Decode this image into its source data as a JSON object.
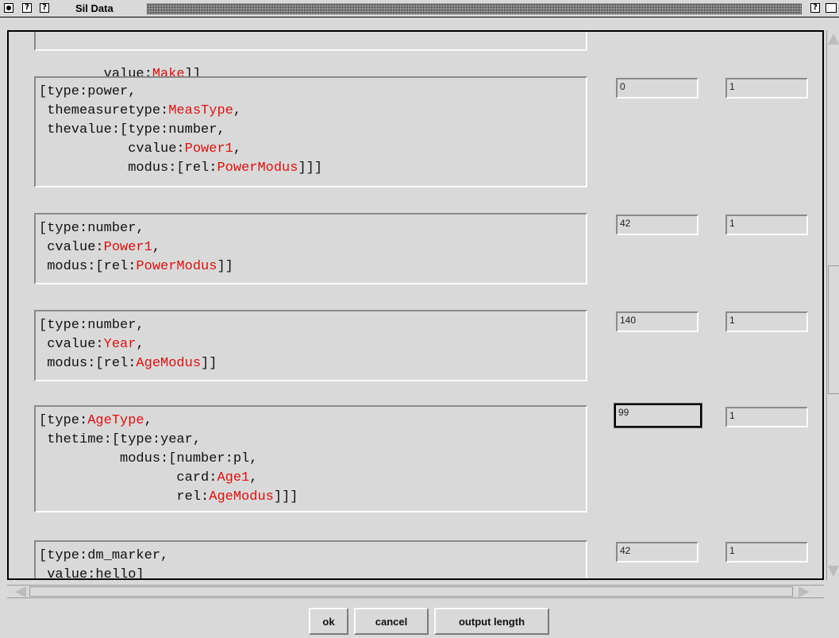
{
  "window": {
    "title": "Sil Data",
    "title_icon_1": "?",
    "title_icon_2": "?",
    "title_icon_right": "?"
  },
  "boxes": [
    {
      "lines": [
        [
          {
            "t": "        value:",
            "c": "k"
          },
          {
            "t": "Make",
            "c": "red"
          },
          {
            "t": "]]",
            "c": "k"
          }
        ]
      ]
    },
    {
      "lines": [
        [
          {
            "t": "[type:power,",
            "c": "k"
          }
        ],
        [
          {
            "t": " themeasuretype:",
            "c": "k"
          },
          {
            "t": "MeasType",
            "c": "red"
          },
          {
            "t": ",",
            "c": "k"
          }
        ],
        [
          {
            "t": " thevalue:[type:number,",
            "c": "k"
          }
        ],
        [
          {
            "t": "           cvalue:",
            "c": "k"
          },
          {
            "t": "Power1",
            "c": "red"
          },
          {
            "t": ",",
            "c": "k"
          }
        ],
        [
          {
            "t": "           modus:[rel:",
            "c": "k"
          },
          {
            "t": "PowerModus",
            "c": "red"
          },
          {
            "t": "]]]",
            "c": "k"
          }
        ]
      ],
      "count": "0",
      "weight": "1"
    },
    {
      "lines": [
        [
          {
            "t": "[type:number,",
            "c": "k"
          }
        ],
        [
          {
            "t": " cvalue:",
            "c": "k"
          },
          {
            "t": "Power1",
            "c": "red"
          },
          {
            "t": ",",
            "c": "k"
          }
        ],
        [
          {
            "t": " modus:[rel:",
            "c": "k"
          },
          {
            "t": "PowerModus",
            "c": "red"
          },
          {
            "t": "]]",
            "c": "k"
          }
        ]
      ],
      "count": "42",
      "weight": "1"
    },
    {
      "lines": [
        [
          {
            "t": "[type:number,",
            "c": "k"
          }
        ],
        [
          {
            "t": " cvalue:",
            "c": "k"
          },
          {
            "t": "Year",
            "c": "red"
          },
          {
            "t": ",",
            "c": "k"
          }
        ],
        [
          {
            "t": " modus:[rel:",
            "c": "k"
          },
          {
            "t": "AgeModus",
            "c": "red"
          },
          {
            "t": "]]",
            "c": "k"
          }
        ]
      ],
      "count": "140",
      "weight": "1"
    },
    {
      "lines": [
        [
          {
            "t": "[type:",
            "c": "k"
          },
          {
            "t": "AgeType",
            "c": "red"
          },
          {
            "t": ",",
            "c": "k"
          }
        ],
        [
          {
            "t": " thetime:[type:year,",
            "c": "k"
          }
        ],
        [
          {
            "t": "          modus:[number:pl,",
            "c": "k"
          }
        ],
        [
          {
            "t": "                 card:",
            "c": "k"
          },
          {
            "t": "Age1",
            "c": "red"
          },
          {
            "t": ",",
            "c": "k"
          }
        ],
        [
          {
            "t": "                 rel:",
            "c": "k"
          },
          {
            "t": "AgeModus",
            "c": "red"
          },
          {
            "t": "]]]",
            "c": "k"
          }
        ]
      ],
      "count": "99",
      "weight": "1"
    },
    {
      "lines": [
        [
          {
            "t": "[type:dm_marker,",
            "c": "k"
          }
        ],
        [
          {
            "t": " value:hello]",
            "c": "k"
          }
        ]
      ],
      "count": "42",
      "weight": "1"
    }
  ],
  "buttons": {
    "ok": "ok",
    "cancel": "cancel",
    "output_length": "output length"
  },
  "colors": {
    "background": "#d9d9d9",
    "variable": "#e01010"
  }
}
